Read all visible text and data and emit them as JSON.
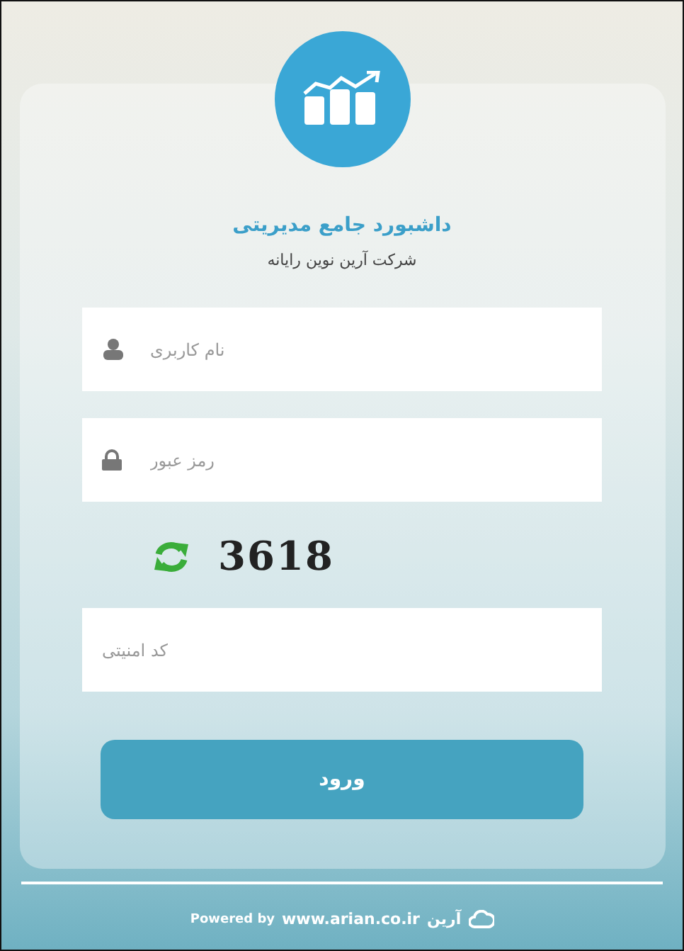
{
  "header": {
    "title": "داشبورد جامع مدیریتی",
    "subtitle": "شرکت آرین نوین رایانه"
  },
  "fields": [
    {
      "kind": "user",
      "placeholder": "نام کاربری"
    },
    {
      "kind": "lock",
      "placeholder": "رمز عبور"
    }
  ],
  "captcha": {
    "code": "3618",
    "placeholder": "کد امنیتی"
  },
  "button": "ورود",
  "footer": {
    "powered": "Powered by",
    "site": "www.arian.co.ir",
    "logo": "آرین"
  }
}
